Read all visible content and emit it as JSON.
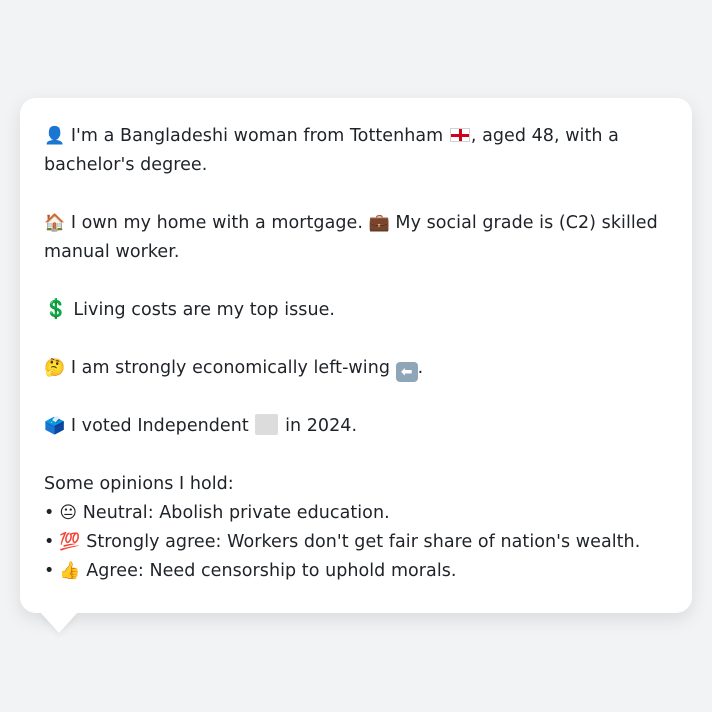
{
  "persona": {
    "line1": {
      "icon": "bust-in-silhouette",
      "text_before_flag": "I'm a Bangladeshi woman from Tottenham",
      "flag": "england-flag",
      "text_after_flag": ", aged 48, with a bachelor's degree."
    },
    "line2": {
      "icon1": "house",
      "text1": "I own my home with a mortgage.",
      "icon2": "briefcase",
      "text2": "My social grade is (C2) skilled manual worker."
    },
    "line3": {
      "icon": "heavy-dollar-sign",
      "text": "Living costs are my top issue."
    },
    "line4": {
      "icon": "thinking-face",
      "text": "I am strongly economically left-wing",
      "end_icon": "left-arrow",
      "end_punct": "."
    },
    "line5": {
      "icon": "ballot-box",
      "text_before": "I voted Independent",
      "party_color": "#dcdcdc",
      "text_after": "in 2024."
    },
    "opinions_heading": "Some opinions I hold:",
    "opinions": [
      {
        "icon": "neutral-face",
        "emoji": "😐",
        "text": "Neutral: Abolish private education."
      },
      {
        "icon": "hundred-points",
        "emoji": "💯",
        "text": "Strongly agree: Workers don't get fair share of nation's wealth."
      },
      {
        "icon": "thumbs-up",
        "emoji": "👍",
        "text": "Agree: Need censorship to uphold morals."
      }
    ],
    "bullet": "•"
  },
  "colors": {
    "background": "#f2f3f5",
    "card": "#ffffff",
    "text": "#1f2328"
  }
}
